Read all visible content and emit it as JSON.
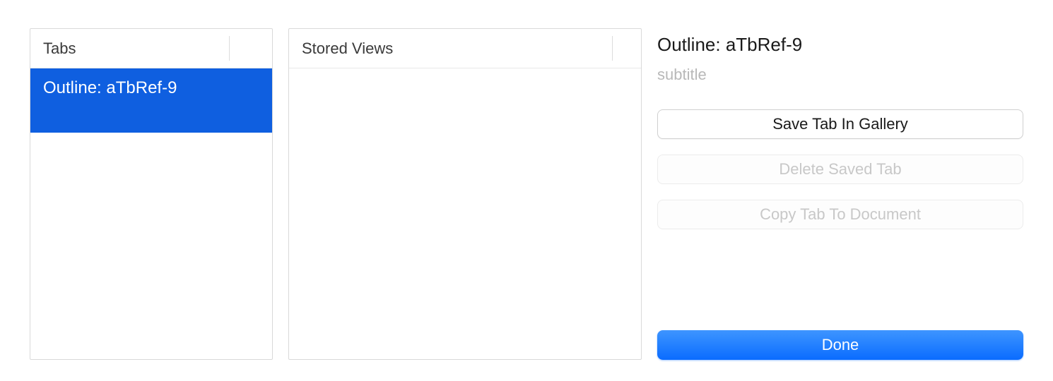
{
  "tabsPanel": {
    "header": "Tabs",
    "items": [
      {
        "label": "Outline: aTbRef-9",
        "selected": true
      }
    ]
  },
  "storedViewsPanel": {
    "header": "Stored Views",
    "items": []
  },
  "detail": {
    "title": "Outline: aTbRef-9",
    "subtitleValue": "",
    "subtitlePlaceholder": "subtitle"
  },
  "buttons": {
    "saveTab": "Save Tab In Gallery",
    "deleteTab": "Delete Saved Tab",
    "copyTab": "Copy Tab To Document",
    "done": "Done"
  }
}
